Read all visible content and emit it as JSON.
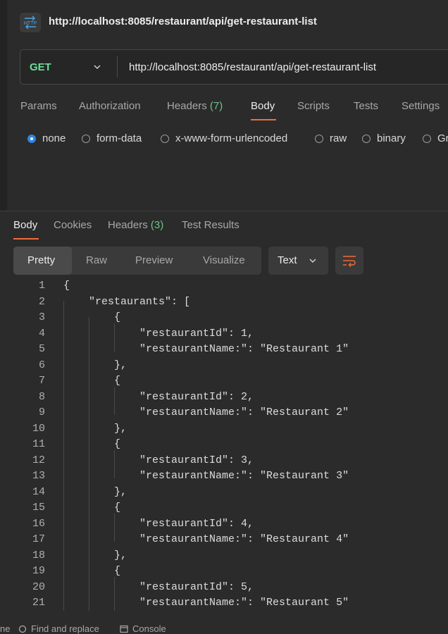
{
  "request": {
    "title": "http://localhost:8085/restaurant/api/get-restaurant-list",
    "badge": "HTTP",
    "method": "GET",
    "url": "http://localhost:8085/restaurant/api/get-restaurant-list",
    "method_color": "#6bdd9a"
  },
  "request_tabs": {
    "params": "Params",
    "authorization": "Authorization",
    "headers": "Headers",
    "headers_count": "(7)",
    "body": "Body",
    "scripts": "Scripts",
    "tests": "Tests",
    "settings": "Settings",
    "active": "Body"
  },
  "body_options": {
    "none": "none",
    "form_data": "form-data",
    "urlencoded": "x-www-form-urlencoded",
    "raw": "raw",
    "binary": "binary",
    "graphql_partial": "Gr",
    "selected": "none"
  },
  "response_tabs": {
    "body": "Body",
    "cookies": "Cookies",
    "headers": "Headers",
    "headers_count": "(3)",
    "test_results": "Test Results",
    "active": "Body"
  },
  "view_modes": {
    "pretty": "Pretty",
    "raw": "Raw",
    "preview": "Preview",
    "visualize": "Visualize",
    "active": "Pretty"
  },
  "format": {
    "selected": "Text"
  },
  "code_lines": [
    {
      "n": "1",
      "t": "{"
    },
    {
      "n": "2",
      "t": "    \"restaurants\": ["
    },
    {
      "n": "3",
      "t": "        {"
    },
    {
      "n": "4",
      "t": "            \"restaurantId\": 1,"
    },
    {
      "n": "5",
      "t": "            \"restaurantName:\": \"Restaurant 1\""
    },
    {
      "n": "6",
      "t": "        },"
    },
    {
      "n": "7",
      "t": "        {"
    },
    {
      "n": "8",
      "t": "            \"restaurantId\": 2,"
    },
    {
      "n": "9",
      "t": "            \"restaurantName:\": \"Restaurant 2\""
    },
    {
      "n": "10",
      "t": "        },"
    },
    {
      "n": "11",
      "t": "        {"
    },
    {
      "n": "12",
      "t": "            \"restaurantId\": 3,"
    },
    {
      "n": "13",
      "t": "            \"restaurantName:\": \"Restaurant 3\""
    },
    {
      "n": "14",
      "t": "        },"
    },
    {
      "n": "15",
      "t": "        {"
    },
    {
      "n": "16",
      "t": "            \"restaurantId\": 4,"
    },
    {
      "n": "17",
      "t": "            \"restaurantName:\": \"Restaurant 4\""
    },
    {
      "n": "18",
      "t": "        },"
    },
    {
      "n": "19",
      "t": "        {"
    },
    {
      "n": "20",
      "t": "            \"restaurantId\": 5,"
    },
    {
      "n": "21",
      "t": "            \"restaurantName:\": \"Restaurant 5\""
    }
  ],
  "status_bar": {
    "partial_left": "ne",
    "find_replace": "Find and replace",
    "console": "Console"
  },
  "colors": {
    "accent": "#f26b3a",
    "radio_selected": "#2f86e8",
    "count_green": "#6bc48a"
  }
}
